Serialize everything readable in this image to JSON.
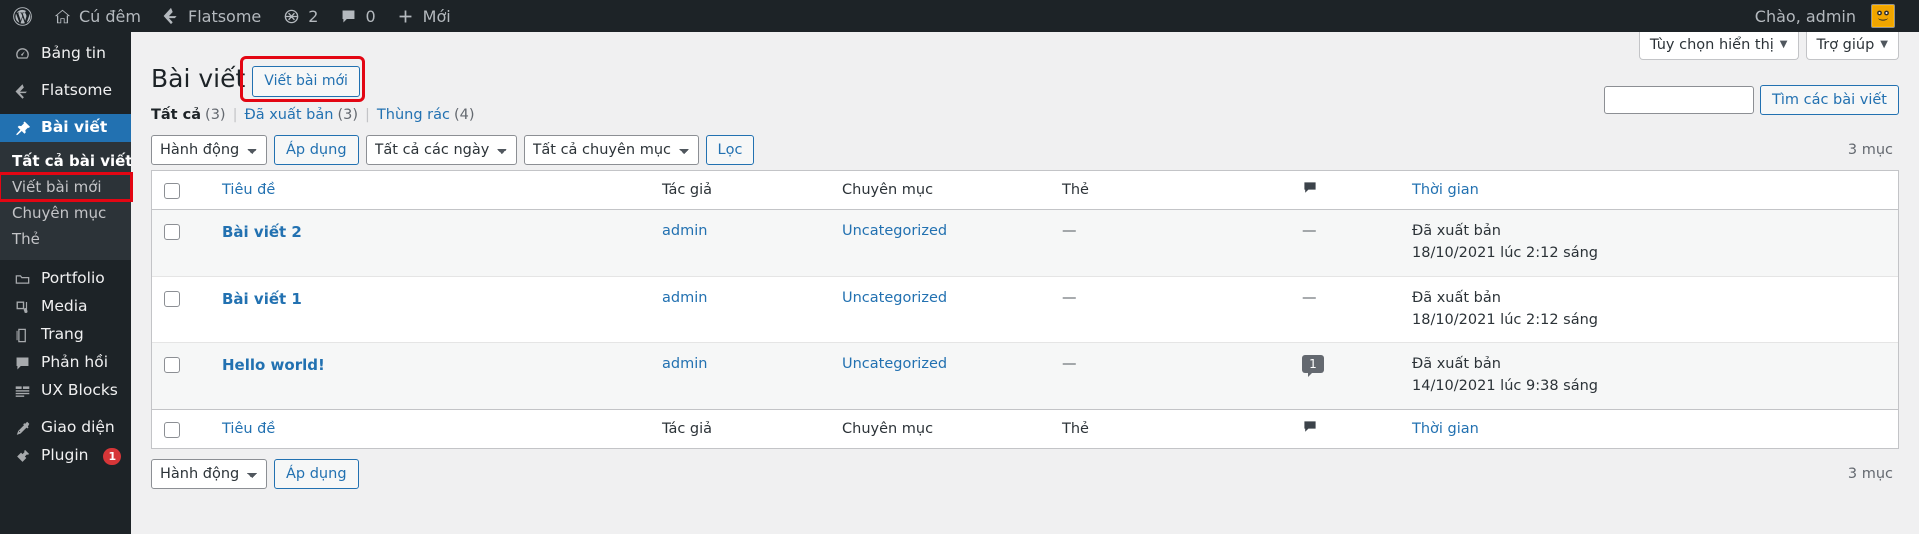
{
  "adminbar": {
    "logo_icon": "wordpress-icon",
    "items": [
      {
        "icon": "home-icon",
        "label": "Cú đêm"
      },
      {
        "icon": "flatsome-icon",
        "label": "Flatsome"
      },
      {
        "icon": "updates-icon",
        "label": "2"
      },
      {
        "icon": "comment-icon",
        "label": "0"
      },
      {
        "icon": "plus-icon",
        "label": "Mới"
      }
    ],
    "greeting": "Chào, admin",
    "avatar_icon": "user-avatar"
  },
  "sidebar": {
    "items": [
      {
        "icon": "dashboard-icon",
        "label": "Bảng tin",
        "current": false
      },
      {
        "icon": "flatsome-icon",
        "label": "Flatsome",
        "current": false
      },
      {
        "icon": "pin-icon",
        "label": "Bài viết",
        "current": true
      },
      {
        "icon": "portfolio-icon",
        "label": "Portfolio",
        "current": false
      },
      {
        "icon": "media-icon",
        "label": "Media",
        "current": false
      },
      {
        "icon": "page-icon",
        "label": "Trang",
        "current": false
      },
      {
        "icon": "comments-icon",
        "label": "Phản hồi",
        "current": false
      },
      {
        "icon": "blocks-icon",
        "label": "UX Blocks",
        "current": false
      },
      {
        "icon": "appearance-icon",
        "label": "Giao diện",
        "current": false
      },
      {
        "icon": "plugin-icon",
        "label": "Plugin",
        "current": false,
        "badge": "1"
      }
    ],
    "submenu": [
      {
        "label": "Tất cả bài viết",
        "current": true,
        "highlight": false
      },
      {
        "label": "Viết bài mới",
        "current": false,
        "highlight": true
      },
      {
        "label": "Chuyên mục",
        "current": false,
        "highlight": false
      },
      {
        "label": "Thẻ",
        "current": false,
        "highlight": false
      }
    ]
  },
  "screen_meta": {
    "display_options_label": "Tùy chọn hiển thị",
    "help_label": "Trợ giúp",
    "caret": "▼"
  },
  "header": {
    "title": "Bài viết",
    "add_new_label": "Viết bài mới"
  },
  "views": {
    "all": {
      "label": "Tất cả",
      "count": "(3)"
    },
    "published": {
      "label": "Đã xuất bản",
      "count": "(3)"
    },
    "trash": {
      "label": "Thùng rác",
      "count": "(4)"
    },
    "divider": "|"
  },
  "search": {
    "value": "",
    "placeholder": "",
    "button_label": "Tìm các bài viết"
  },
  "tablenav_top": {
    "bulk_action_selected": "Hành động",
    "apply_label": "Áp dụng",
    "date_filter_selected": "Tất cả các ngày",
    "category_filter_selected": "Tất cả chuyên mục",
    "filter_label": "Lọc",
    "displaying_num": "3 mục"
  },
  "tablenav_bottom": {
    "bulk_action_selected": "Hành động",
    "apply_label": "Áp dụng",
    "displaying_num": "3 mục"
  },
  "table": {
    "columns": {
      "title": "Tiêu đề",
      "author": "Tác giả",
      "categories": "Chuyên mục",
      "tags": "Thẻ",
      "comments_icon": "comment-icon",
      "date": "Thời gian"
    },
    "rows": [
      {
        "title": "Bài viết 2",
        "author": "admin",
        "categories": "Uncategorized",
        "tags": "—",
        "comments": "—",
        "comments_is_bubble": false,
        "date_status": "Đã xuất bản",
        "date_value": "18/10/2021 lúc 2:12 sáng"
      },
      {
        "title": "Bài viết 1",
        "author": "admin",
        "categories": "Uncategorized",
        "tags": "—",
        "comments": "—",
        "comments_is_bubble": false,
        "date_status": "Đã xuất bản",
        "date_value": "18/10/2021 lúc 2:12 sáng"
      },
      {
        "title": "Hello world!",
        "author": "admin",
        "categories": "Uncategorized",
        "tags": "—",
        "comments": "1",
        "comments_is_bubble": true,
        "date_status": "Đã xuất bản",
        "date_value": "14/10/2021 lúc 9:38 sáng"
      }
    ]
  },
  "colors": {
    "adminbar_bg": "#1d2327",
    "menu_bg": "#1d2327",
    "submenu_bg": "#2c3338",
    "current_menu": "#2271b1",
    "link": "#2271b1",
    "highlight_outline": "#e30613",
    "badge_red": "#d63638",
    "content_bg": "#f0f0f1"
  }
}
